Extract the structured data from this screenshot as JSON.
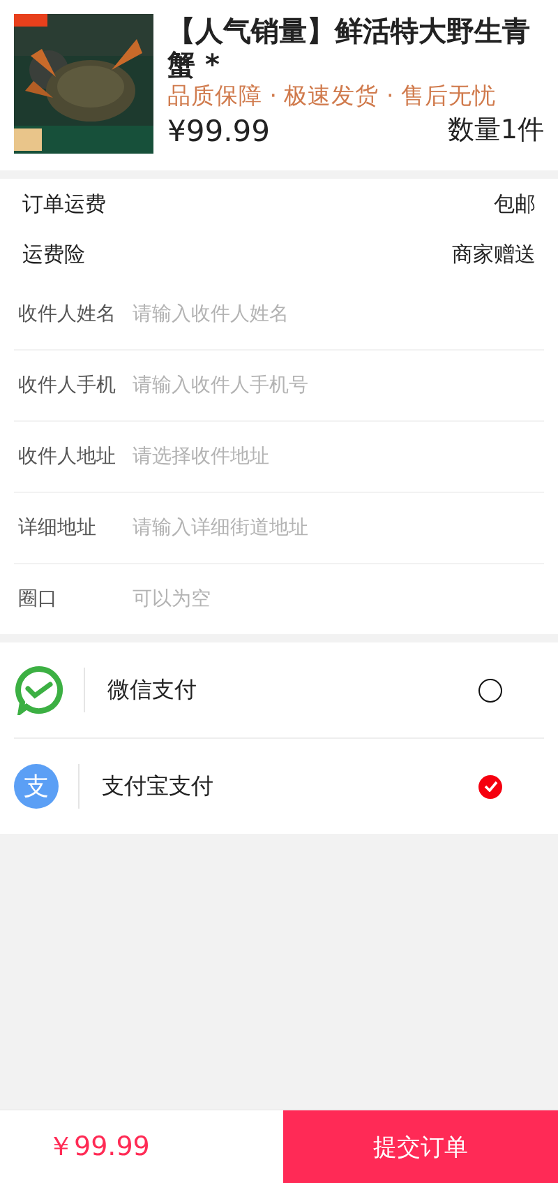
{
  "product": {
    "kind": "picture",
    "title": "【人气销量】鲜活特大野生青蟹 *",
    "tagline": "品质保障 · 极速发货 · 售后无忧",
    "price": "¥99.99",
    "quantity": "数量1件"
  },
  "info_rows": [
    {
      "label": "订单运费",
      "value": "包邮"
    },
    {
      "label": "运费险",
      "value": "商家赠送"
    }
  ],
  "fields": [
    {
      "label": "收件人姓名",
      "placeholder": "请输入收件人姓名"
    },
    {
      "label": "收件人手机",
      "placeholder": "请输入收件人手机号"
    },
    {
      "label": "收件人地址",
      "placeholder": "请选择收件地址"
    },
    {
      "label": "详细地址",
      "placeholder": "请输入详细街道地址"
    },
    {
      "label": "圈口",
      "placeholder": "可以为空"
    }
  ],
  "payment_methods": [
    {
      "kind": "wechat",
      "label": "微信支付",
      "selected": false
    },
    {
      "kind": "alipay",
      "icon_text": "支",
      "label": "支付宝支付",
      "selected": true
    }
  ],
  "footer": {
    "total": "￥99.99",
    "submit": "提交订单"
  }
}
